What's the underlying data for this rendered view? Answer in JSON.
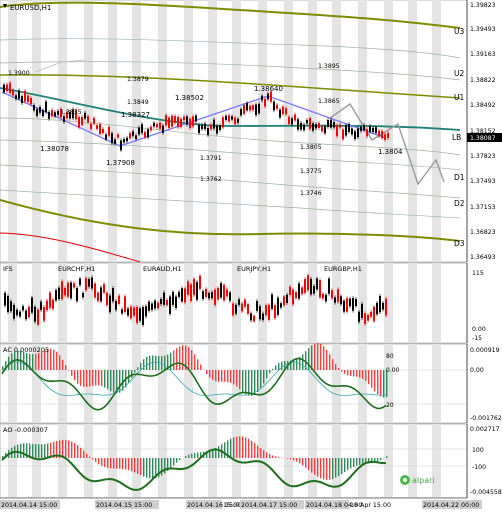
{
  "main": {
    "symbol_title": "EURUSD,H1",
    "price_axis": [
      "1.39823",
      "1.39493",
      "1.39163",
      "1.38822",
      "1.38492",
      "1.38152",
      "1.37823",
      "1.37493",
      "1.37153",
      "1.36823",
      "1.36493"
    ],
    "current_price": "1.38087",
    "levels": [
      "U3",
      "U2",
      "U1",
      "LB",
      "D1",
      "D2",
      "D3"
    ],
    "annotations": [
      "1.3900",
      "1.3879",
      "1.3849",
      "1.3835",
      "1.38327",
      "1.38502",
      "1.38640",
      "1.3895",
      "1.3865",
      "1.38078",
      "1.37908",
      "1.3791",
      "1.3762",
      "1.3805",
      "1.3775",
      "1.3746",
      "1.3804"
    ]
  },
  "indices_panel": {
    "title_left": "IFS",
    "labels": [
      "EURCHF,H1",
      "EURAUD,H1",
      "EURJPY,H1",
      "EURGBP,H1"
    ],
    "axis": [
      "115",
      "0.00",
      "-15"
    ]
  },
  "ac_panel": {
    "title": "AC 0.0000205",
    "axis": [
      "0.000919",
      "0.00",
      "-0.001762"
    ],
    "inner": [
      "80",
      "0.00",
      "20"
    ]
  },
  "ao_panel": {
    "title": "AO -0.000307",
    "axis": [
      "0.002717",
      "100",
      "-100",
      "-0.004558"
    ],
    "brand": "alpari"
  },
  "time_axis": [
    "2014.04.14 15:00",
    "2014.04.15 15:00",
    "2014.04.16 15:00",
    "15:00",
    "2014.04.17 15:00",
    "2014.04.18 04:00",
    "18 Apr 15:00",
    "2014.04.22 00:00"
  ],
  "colors": {
    "bull": "#000000",
    "bear": "#ff0000",
    "channel": "#7b8c00",
    "mid": "#1e8078",
    "trend": "#7f7fff",
    "ac_line": "#1e6e1e"
  }
}
